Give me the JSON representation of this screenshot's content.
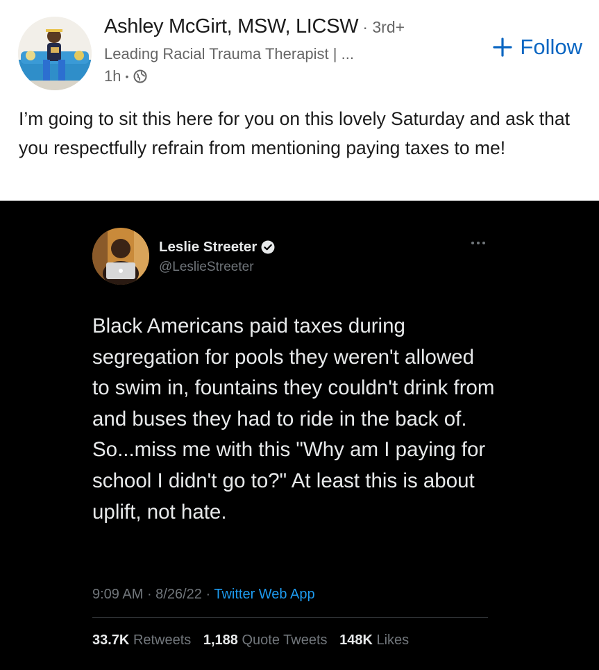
{
  "post": {
    "author": {
      "name": "Ashley McGirt, MSW, LICSW",
      "degree": "· 3rd+",
      "headline": "Leading Racial Trauma Therapist | ...",
      "time": "1h",
      "dot": "•"
    },
    "follow_label": "Follow",
    "text": "I’m going to sit this here for you on this lovely Saturday and ask that you respectfully refrain from mentioning paying taxes to me!"
  },
  "tweet": {
    "name": "Leslie Streeter",
    "handle": "@LeslieStreeter",
    "text": "Black Americans paid taxes during segregation for pools they weren't allowed to swim in, fountains they couldn't drink from and buses they had to ride in the back of. So...miss me with this \"Why am I paying for school I didn't go to?\" At least this is about uplift, not hate.",
    "time": "9:09 AM",
    "date": "8/26/22",
    "sep": " · ",
    "source": "Twitter Web App",
    "stats": {
      "retweets_value": "33.7K",
      "retweets_label": "Retweets",
      "quotes_value": "1,188",
      "quotes_label": "Quote Tweets",
      "likes_value": "148K",
      "likes_label": "Likes"
    }
  },
  "colors": {
    "linkedin_blue": "#0a66c2",
    "twitter_blue": "#1d9bf0",
    "tweet_bg": "#000000"
  },
  "icons": [
    "globe-icon",
    "plus-icon",
    "verified-icon",
    "more-icon"
  ]
}
